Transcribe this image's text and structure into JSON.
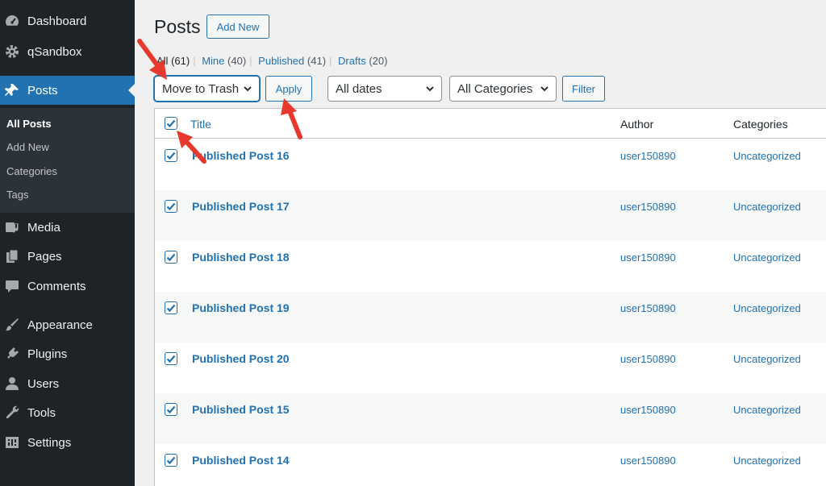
{
  "sidebar": {
    "items": [
      {
        "label": "Dashboard",
        "icon": "dashboard-icon"
      },
      {
        "label": "qSandbox",
        "icon": "gear-icon"
      },
      {
        "label": "Posts",
        "icon": "pin-icon"
      },
      {
        "label": "Media",
        "icon": "media-icon"
      },
      {
        "label": "Pages",
        "icon": "pages-icon"
      },
      {
        "label": "Comments",
        "icon": "comment-icon"
      },
      {
        "label": "Appearance",
        "icon": "brush-icon"
      },
      {
        "label": "Plugins",
        "icon": "plug-icon"
      },
      {
        "label": "Users",
        "icon": "user-icon"
      },
      {
        "label": "Tools",
        "icon": "wrench-icon"
      },
      {
        "label": "Settings",
        "icon": "settings-icon"
      }
    ],
    "submenu": [
      "All Posts",
      "Add New",
      "Categories",
      "Tags"
    ]
  },
  "header": {
    "title": "Posts",
    "add_new": "Add New"
  },
  "views": {
    "all_label": "All",
    "all_count": "(61)",
    "mine_label": "Mine",
    "mine_count": "(40)",
    "published_label": "Published",
    "published_count": "(41)",
    "drafts_label": "Drafts",
    "drafts_count": "(20)",
    "separator": "|"
  },
  "toolbar": {
    "bulk_action": "Move to Trash",
    "apply": "Apply",
    "dates": "All dates",
    "categories": "All Categories",
    "filter": "Filter"
  },
  "table": {
    "columns": {
      "title": "Title",
      "author": "Author",
      "categories": "Categories"
    },
    "rows": [
      {
        "title": "Published Post 16",
        "author": "user150890",
        "category": "Uncategorized",
        "checked": true
      },
      {
        "title": "Published Post 17",
        "author": "user150890",
        "category": "Uncategorized",
        "checked": true
      },
      {
        "title": "Published Post 18",
        "author": "user150890",
        "category": "Uncategorized",
        "checked": true
      },
      {
        "title": "Published Post 19",
        "author": "user150890",
        "category": "Uncategorized",
        "checked": true
      },
      {
        "title": "Published Post 20",
        "author": "user150890",
        "category": "Uncategorized",
        "checked": true
      },
      {
        "title": "Published Post 15",
        "author": "user150890",
        "category": "Uncategorized",
        "checked": true
      },
      {
        "title": "Published Post 14",
        "author": "user150890",
        "category": "Uncategorized",
        "checked": true
      }
    ]
  },
  "colors": {
    "sidebar_bg": "#1d2327",
    "accent": "#2271b1",
    "annotation_arrow": "#e8392f"
  }
}
